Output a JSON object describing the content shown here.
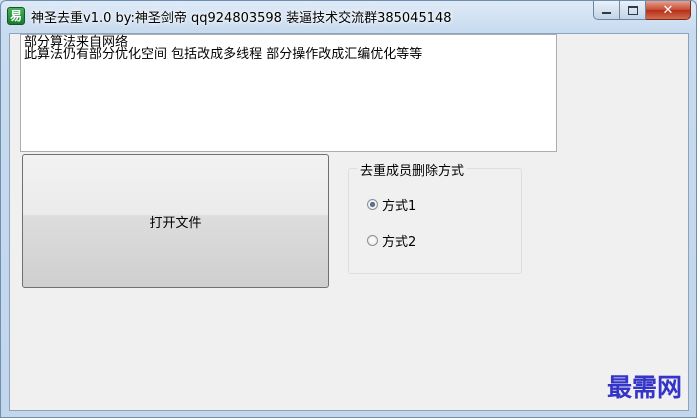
{
  "window": {
    "title": "神圣去重v1.0 by:神圣剑帝 qq924803598 装逼技术交流群385045148",
    "app_icon": "app-logo-icon",
    "controls": {
      "minimize": "minimize-icon",
      "maximize": "maximize-icon",
      "close": "close-icon"
    }
  },
  "textbox": {
    "lines": [
      "部分算法来自网络",
      "此算法仍有部分优化空间 包括改成多线程 部分操作改成汇编优化等等"
    ]
  },
  "open_button": {
    "label": "打开文件"
  },
  "group": {
    "title": "去重成员删除方式",
    "options": [
      {
        "label": "方式1",
        "checked": true
      },
      {
        "label": "方式2",
        "checked": false
      }
    ]
  },
  "watermark": "最需网",
  "colors": {
    "accent_watermark": "#3434c8",
    "close_button": "#c74a34"
  }
}
